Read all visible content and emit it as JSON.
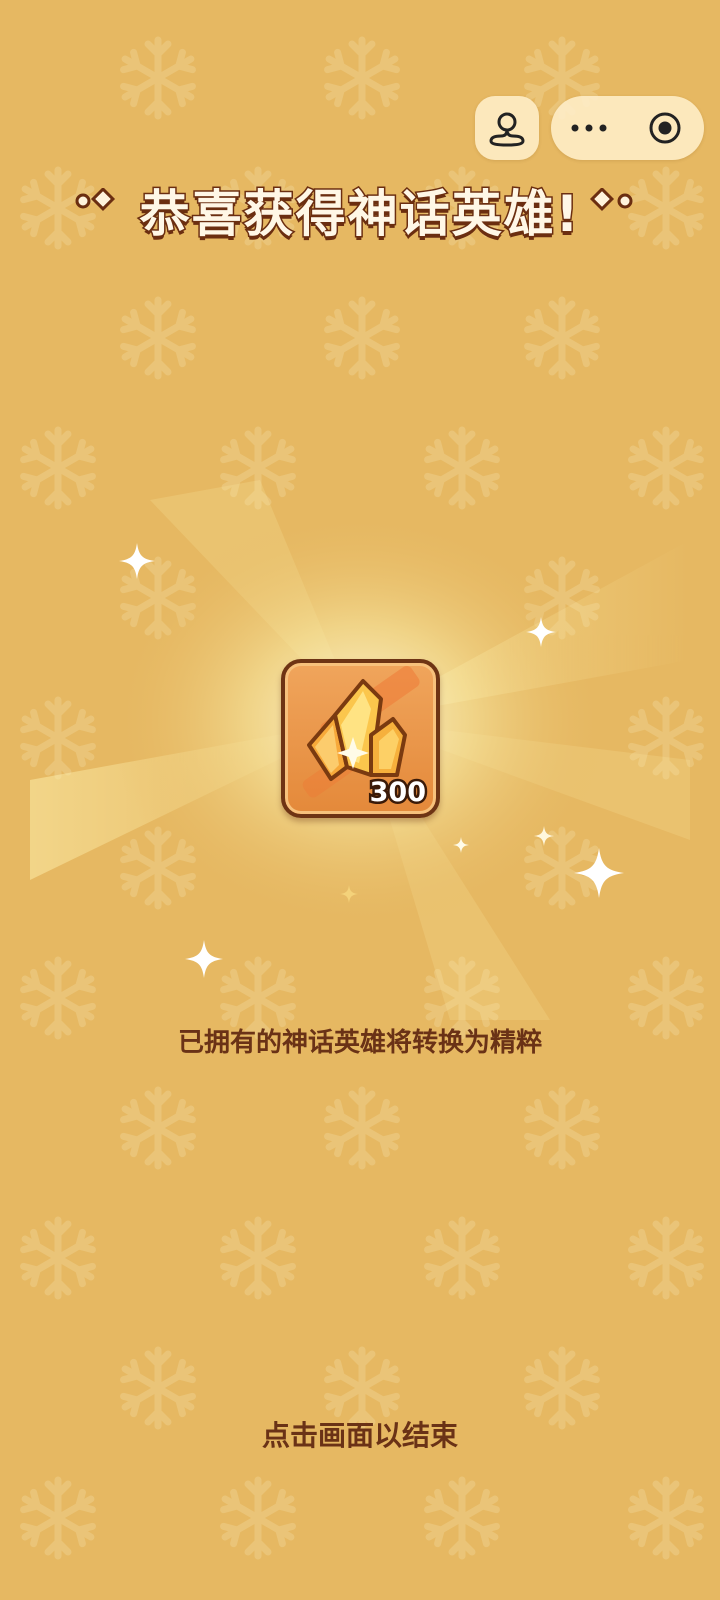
{
  "header": {
    "title": "恭喜获得神话英雄!"
  },
  "mini_program_bar": {
    "profile_icon": "user-icon",
    "more_icon": "more-dots-icon",
    "close_icon": "target-close-icon"
  },
  "reward": {
    "item_icon": "gold-crystal-essence",
    "quantity": "300"
  },
  "message": "已拥有的神话英雄将转换为精粹",
  "tap_to_close": "点击画面以结束",
  "colors": {
    "background": "#e6b862",
    "text_brown": "#6a3216",
    "card_orange": "#e4893a"
  }
}
